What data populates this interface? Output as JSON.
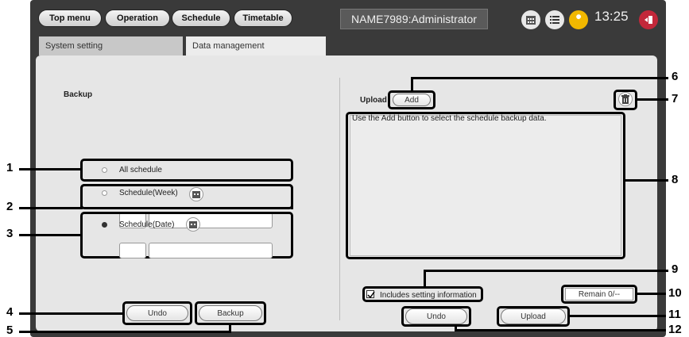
{
  "topbar": {
    "menu_items": [
      "Top menu",
      "Operation",
      "Schedule",
      "Timetable"
    ],
    "device_label": "NAME7989:Administrator",
    "time": "13:25"
  },
  "tabs": {
    "system_setting": "System setting",
    "data_management": "Data management"
  },
  "backup": {
    "title": "Backup",
    "all_schedule": "All schedule",
    "schedule_week": "Schedule(Week)",
    "schedule_date": "Schedule(Date)",
    "undo": "Undo",
    "backup_button": "Backup"
  },
  "upload": {
    "title": "Upload",
    "add": "Add",
    "message": "Use the Add button to select the schedule backup data.",
    "includes_setting": "Includes setting information",
    "remain": "Remain 0/--",
    "undo": "Undo",
    "upload_button": "Upload"
  },
  "callouts": [
    "1",
    "2",
    "3",
    "4",
    "5",
    "6",
    "7",
    "8",
    "9",
    "10",
    "11",
    "12"
  ]
}
